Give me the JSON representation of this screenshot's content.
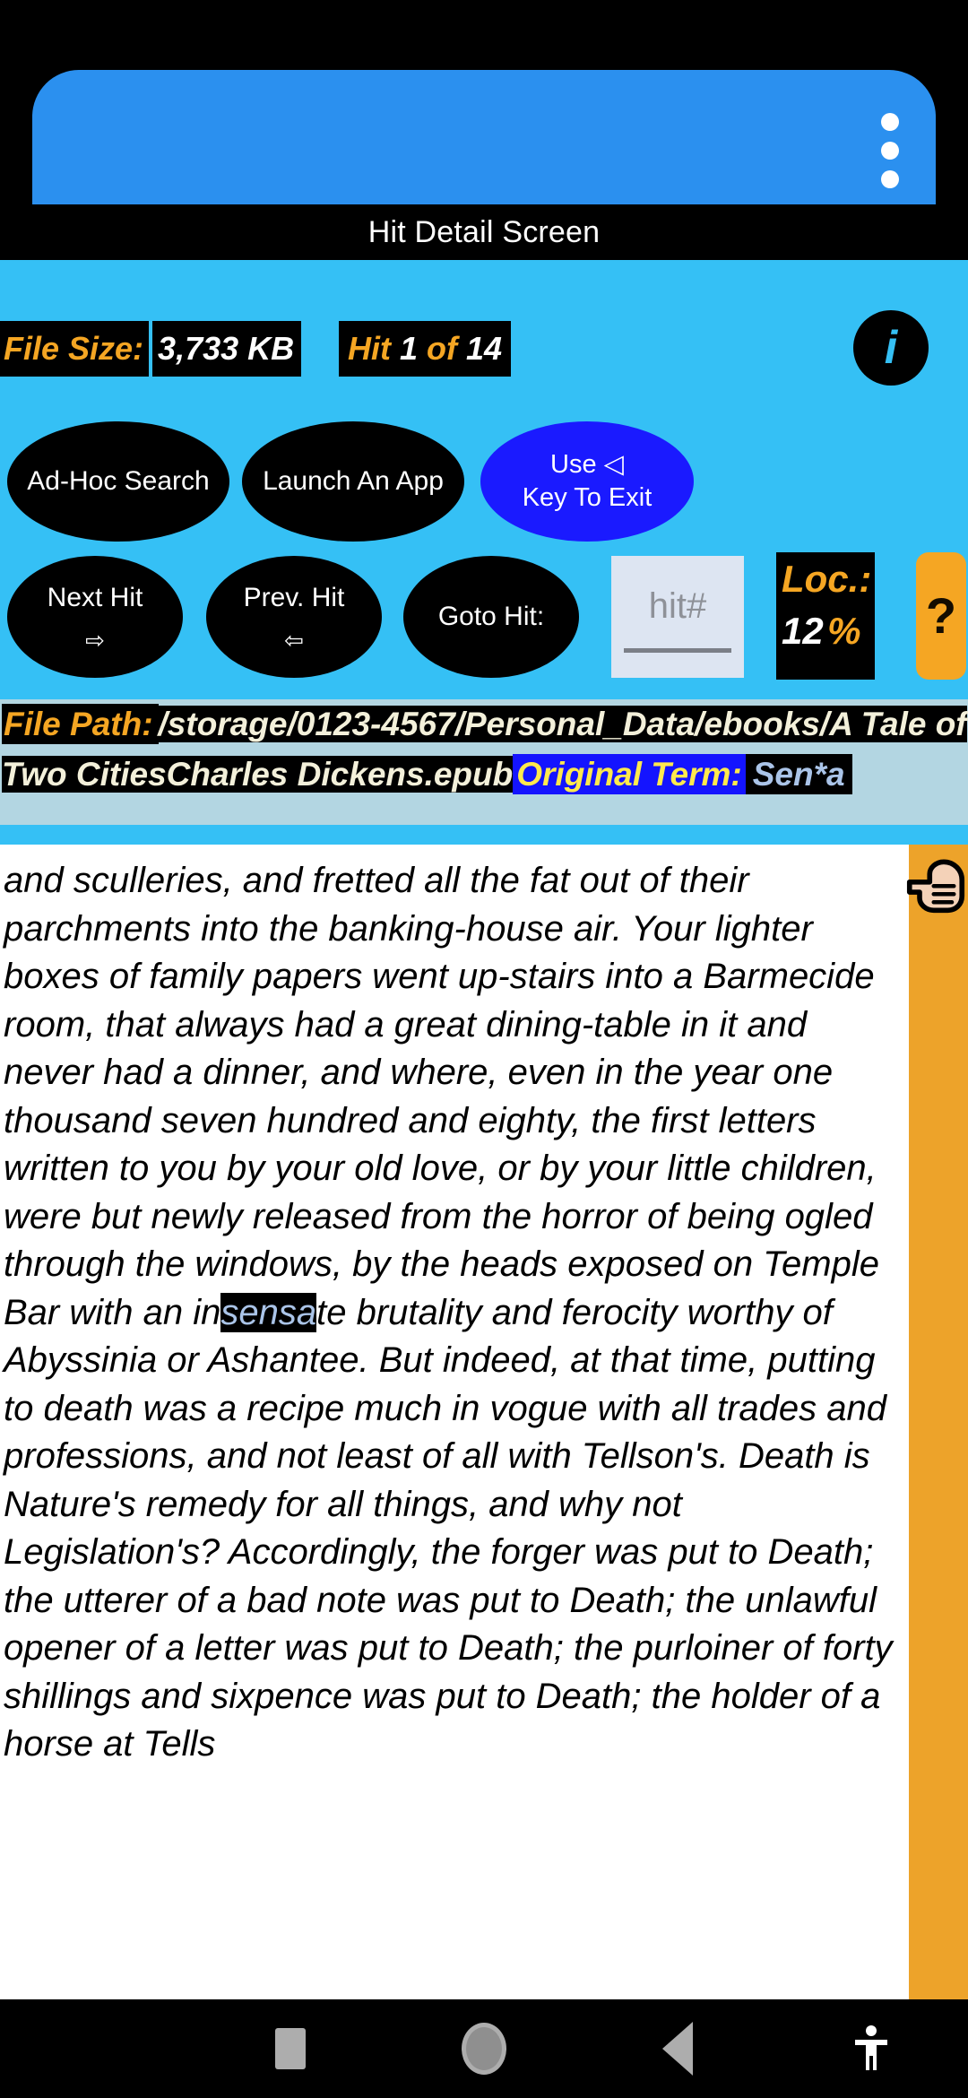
{
  "appbar": {
    "overflow_icon": "overflow-menu-icon"
  },
  "title": "Hit Detail Screen",
  "info": {
    "file_size_label": "File Size:",
    "file_size_value": "3,733 KB",
    "hit_label": "Hit",
    "hit_current": "1",
    "hit_of": "of",
    "hit_total": "14",
    "info_icon": "i"
  },
  "buttons": {
    "adhoc_search": "Ad-Hoc Search",
    "launch_app": "Launch An App",
    "exit_line1": "Use ◁",
    "exit_line2": "Key To Exit",
    "next_hit": "Next Hit",
    "next_hit_arrow": "⇨",
    "prev_hit": "Prev. Hit",
    "prev_hit_arrow": "⇦",
    "goto_hit": "Goto Hit:",
    "help": "?"
  },
  "hit_input": {
    "placeholder": "hit#",
    "value": ""
  },
  "location": {
    "label": "Loc.:",
    "value": "12",
    "unit": "%"
  },
  "path": {
    "label": "File Path:",
    "value": "/storage/0123-4567/Personal_Data/ebooks/A Tale of Two CitiesCharles Dickens.epub",
    "term_label": "Original Term:",
    "term_value": "Sen*a"
  },
  "body": {
    "before_highlight": "and sculleries, and fretted all the fat out of their parchments into the banking-house air. Your lighter boxes of family papers went up-stairs into a Barmecide room, that always had a great dining-table in it and never had a dinner, and where, even in the year one thousand seven hundred and eighty, the first letters written to you by your old love, or by your little children, were but newly released from the horror of being ogled through the windows, by the heads exposed on Temple Bar with an in",
    "highlight": "sensa",
    "after_highlight": "te brutality and ferocity worthy of Abyssinia or Ashantee. But indeed, at that time, putting to death was a recipe much in vogue with all trades and professions, and not least of all with Tellson's. Death is Nature's remedy for all things, and why not Legislation's? Accordingly, the forger was put to Death; the utterer of a bad note was put to Death; the unlawful opener of a letter was put to Death; the purloiner of forty shillings and sixpence was put to Death; the holder of a horse at Tells"
  },
  "rail": {
    "hand_icon": "pointing-hand-icon"
  },
  "navbar": {
    "recents": "recents-square-icon",
    "home": "home-circle-icon",
    "back": "back-triangle-icon",
    "accessibility": "accessibility-icon"
  },
  "colors": {
    "appbar": "#2b90ef",
    "panel": "#35c0f5",
    "accent_orange": "#f5a623",
    "rail_orange": "#eda32a",
    "exit_blue": "#1a1aff",
    "path_bg": "#b3d6e2",
    "term_blue": "#1414ff",
    "highlight_text": "#aac4e8"
  }
}
